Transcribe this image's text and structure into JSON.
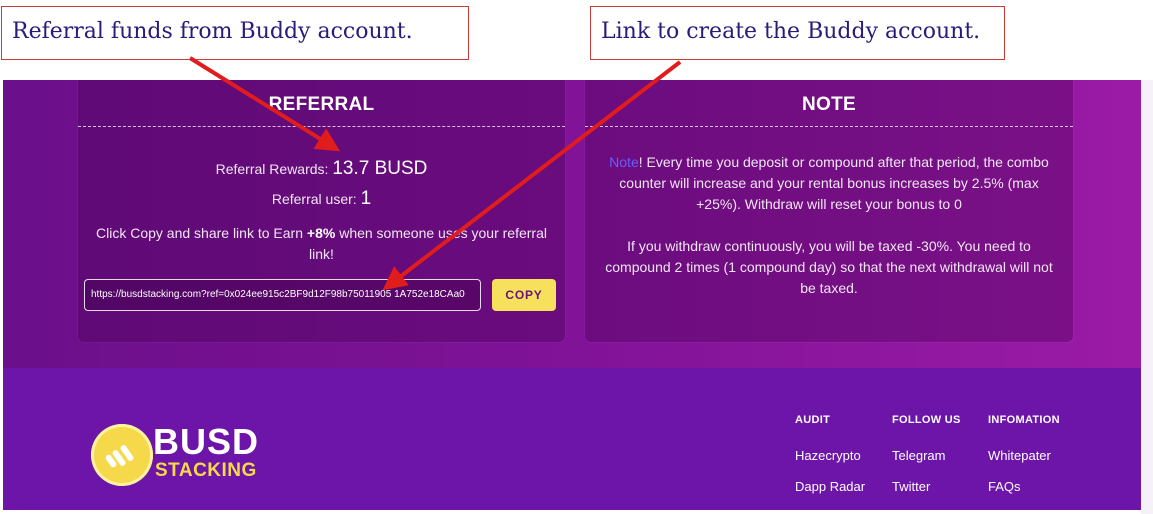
{
  "annotations": {
    "callout_1": "Referral funds from Buddy account.",
    "callout_2": "Link to create the Buddy account."
  },
  "referral": {
    "title": "REFERRAL",
    "rewards_label": "Referral Rewards:",
    "rewards_value": "13.7 BUSD",
    "user_label": "Referral user:",
    "user_value": "1",
    "desc_before": "Click Copy and share link to Earn",
    "desc_bold": "+8%",
    "desc_after": "when someone uses your referral link!",
    "link_value": "https://busdstacking.com?ref=0x024ee915c2BF9d12F98b75011905 1A752e18CAa0",
    "copy_label": "COPY"
  },
  "note": {
    "title": "NOTE",
    "highlight": "Note",
    "p1_rest": "! Every time you deposit or compound after that period, the combo counter will increase and your rental bonus increases by 2.5% (max +25%). Withdraw will reset your bonus to 0",
    "p2": "If you withdraw continuously, you will be taxed -30%. You need to compound 2 times (1 compound day) so that the next withdrawal will not be taxed."
  },
  "footer": {
    "logo_line1": "BUSD",
    "logo_line2": "STACKING",
    "columns": [
      {
        "heading": "AUDIT",
        "links": [
          "Hazecrypto",
          "Dapp Radar"
        ]
      },
      {
        "heading": "FOLLOW US",
        "links": [
          "Telegram",
          "Twitter"
        ]
      },
      {
        "heading": "INFOMATION",
        "links": [
          "Whitepater",
          "FAQs"
        ]
      }
    ]
  },
  "colors": {
    "background_purple": "#7e1296",
    "footer_purple": "#6d15a8",
    "copy_button": "#f7e15c",
    "logo_yellow": "#f5d94a",
    "annotation_red": "#e01c1c",
    "note_highlight": "#6a5cff"
  },
  "icons": {
    "logo": "busd-coin-logo-icon"
  }
}
